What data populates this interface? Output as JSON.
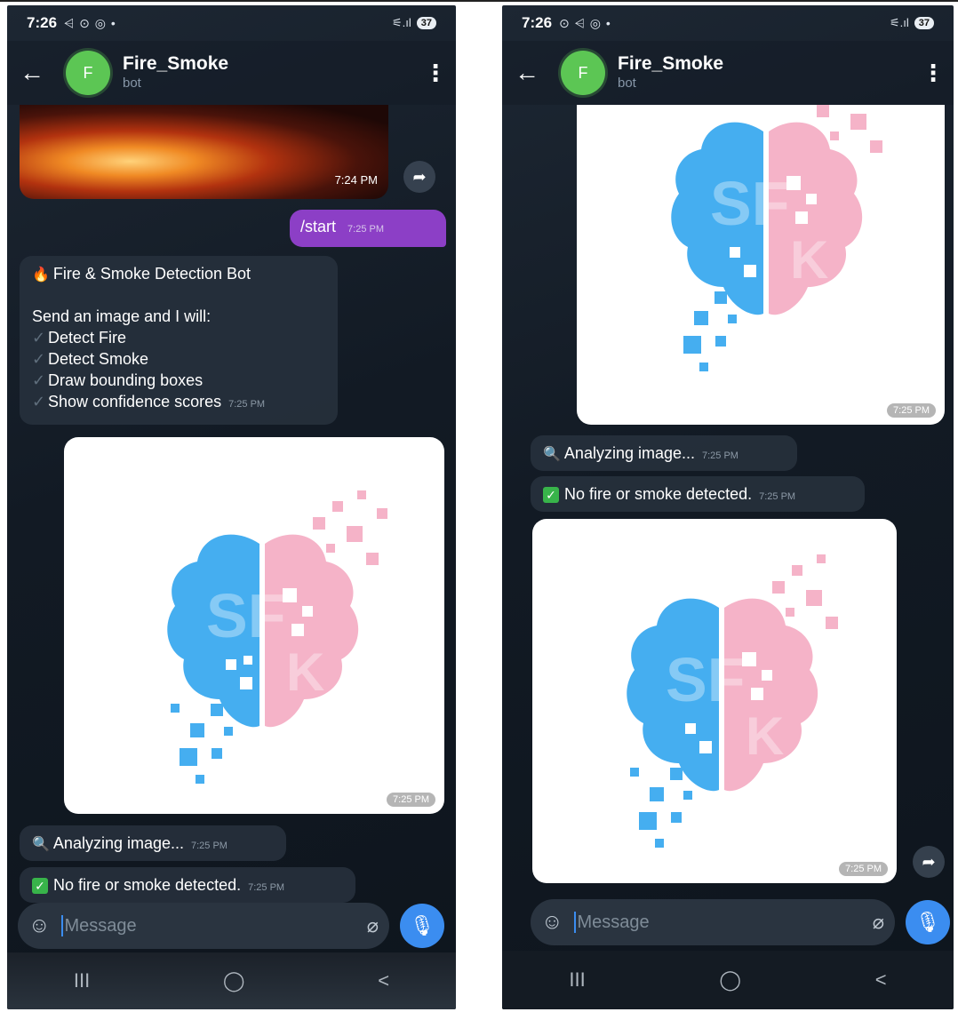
{
  "status_bar": {
    "left_time": "7:26",
    "left_icons": "⩤ ⊙ ◎ •",
    "right_time": "7:26",
    "right_icons": "⊙ ⩤ ◎ •",
    "signal": "⚟.ıl",
    "battery": "37"
  },
  "header": {
    "back_icon": "←",
    "avatar_letter": "F",
    "title": "Fire_Smoke",
    "subtitle": "bot",
    "menu_icon": "⋮"
  },
  "left": {
    "fire_photo_time": "7:24 PM",
    "start_command": "/start",
    "start_time": "7:25 PM",
    "bot_title": "Fire & Smoke Detection Bot",
    "bot_intro": "Send an image and I will:",
    "bot_items": [
      "Detect Fire",
      "Detect Smoke",
      "Draw bounding boxes",
      "Show confidence scores"
    ],
    "bot_time": "7:25 PM",
    "photo_time": "7:25 PM",
    "analyzing_text": "Analyzing image...",
    "analyzing_time": "7:25 PM",
    "result_text": "No fire or smoke detected.",
    "result_time": "7:25 PM"
  },
  "right": {
    "top_photo_time": "7:25 PM",
    "analyzing_text": "Analyzing image...",
    "analyzing_time": "7:25 PM",
    "result_text": "No fire or smoke detected.",
    "result_time": "7:25 PM",
    "photo_time": "7:25 PM"
  },
  "input": {
    "placeholder": "Message",
    "emoji_icon": "☺",
    "clip_icon": "⌀",
    "mic_icon": "🎙"
  },
  "navbar": {
    "recent": "III",
    "home": "◯",
    "back": "<"
  },
  "icons": {
    "share": "➦",
    "check": "✓",
    "magnifier": "🔍",
    "fire": "🔥",
    "green_check": "✓"
  },
  "colors": {
    "outgoing_bubble": "#8c3fc6",
    "avatar": "#5cc654",
    "accent": "#3b8df0",
    "brain_left": "#45aef0",
    "brain_right": "#f5b3c8"
  }
}
